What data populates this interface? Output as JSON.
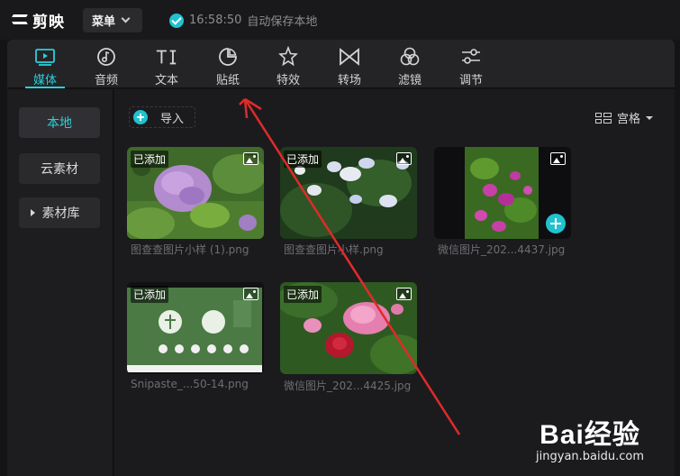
{
  "app": {
    "logo_text": "剪映",
    "menu_label": "菜单",
    "autosave_time": "16:58:50",
    "autosave_text": "自动保存本地"
  },
  "tabs": [
    {
      "label": "媒体",
      "icon": "media-icon",
      "active": true
    },
    {
      "label": "音频",
      "icon": "audio-icon"
    },
    {
      "label": "文本",
      "icon": "text-icon"
    },
    {
      "label": "贴纸",
      "icon": "sticker-icon"
    },
    {
      "label": "特效",
      "icon": "effects-icon"
    },
    {
      "label": "转场",
      "icon": "transition-icon"
    },
    {
      "label": "滤镜",
      "icon": "filter-icon"
    },
    {
      "label": "调节",
      "icon": "adjust-icon"
    }
  ],
  "sidebar": {
    "items": [
      {
        "label": "本地",
        "active": true
      },
      {
        "label": "云素材"
      },
      {
        "label": "素材库",
        "expandable": true
      }
    ]
  },
  "main": {
    "import_label": "导入",
    "view_label": "宫格",
    "badge_label": "已添加",
    "cards": [
      {
        "name": "图查查图片小样 (1).png",
        "badge": true
      },
      {
        "name": "图查查图片小样.png",
        "badge": true
      },
      {
        "name": "微信图片_202...4437.jpg",
        "badge": false
      },
      {
        "name": "Snipaste_...50-14.png",
        "badge": true
      },
      {
        "name": "微信图片_202...4425.jpg",
        "badge": true
      }
    ]
  },
  "watermark": {
    "brand": "Bai经验",
    "url": "jingyan.baidu.com"
  },
  "colors": {
    "accent": "#2ad0d8",
    "annotation": "#e02a2a"
  }
}
